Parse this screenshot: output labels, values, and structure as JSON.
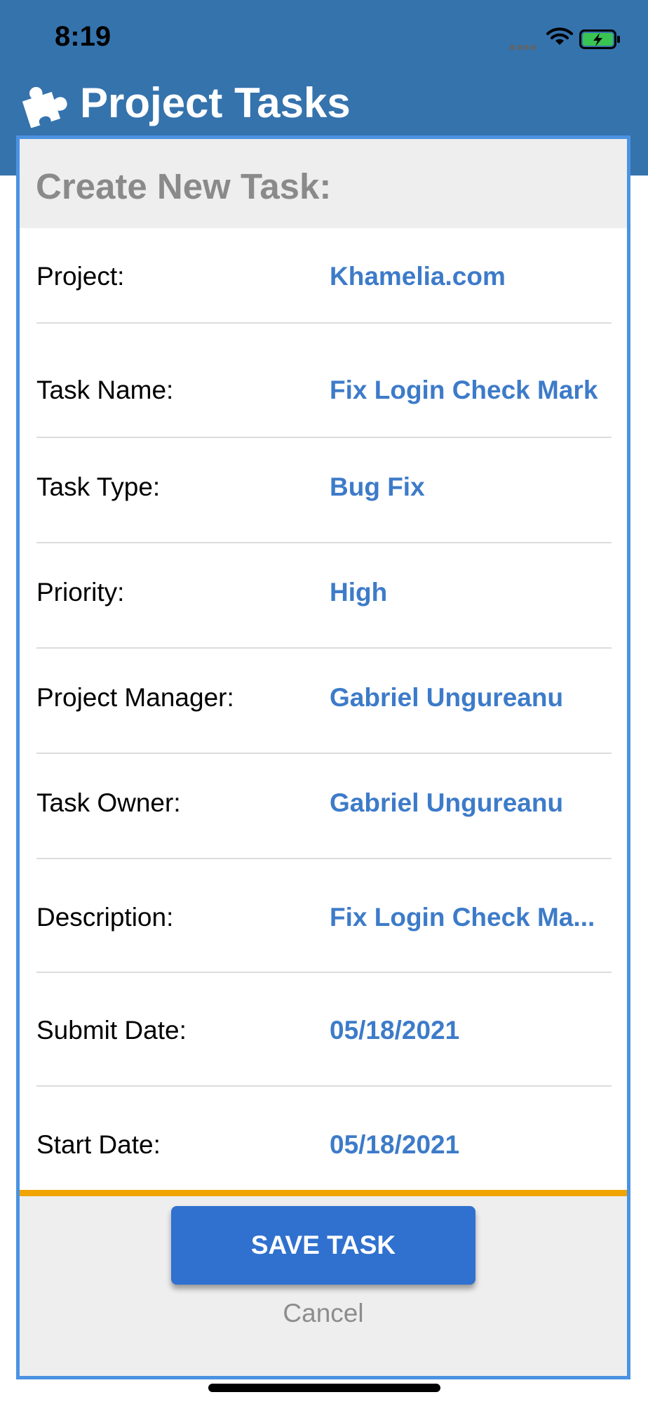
{
  "status_bar": {
    "time": "8:19"
  },
  "header": {
    "title": "Project Tasks",
    "icon": "puzzle-piece-icon"
  },
  "form": {
    "title": "Create New Task:",
    "rows": [
      {
        "label": "Project:",
        "value": "Khamelia.com"
      },
      {
        "label": "Task Name:",
        "value": "Fix Login Check Mark"
      },
      {
        "label": "Task Type:",
        "value": "Bug Fix"
      },
      {
        "label": "Priority:",
        "value": "High"
      },
      {
        "label": "Project Manager:",
        "value": "Gabriel Ungureanu"
      },
      {
        "label": "Task Owner:",
        "value": "Gabriel Ungureanu"
      },
      {
        "label": "Description:",
        "value": "Fix Login Check Ma..."
      },
      {
        "label": "Submit Date:",
        "value": "05/18/2021"
      },
      {
        "label": "Start Date:",
        "value": "05/18/2021"
      }
    ]
  },
  "actions": {
    "save_label": "SAVE TASK",
    "cancel_label": "Cancel"
  },
  "colors": {
    "header": "#3573ad",
    "panel_border": "#4b93e2",
    "value_text": "#3d7bc9",
    "accent_bar": "#f0a400",
    "save_button": "#3071cf"
  }
}
